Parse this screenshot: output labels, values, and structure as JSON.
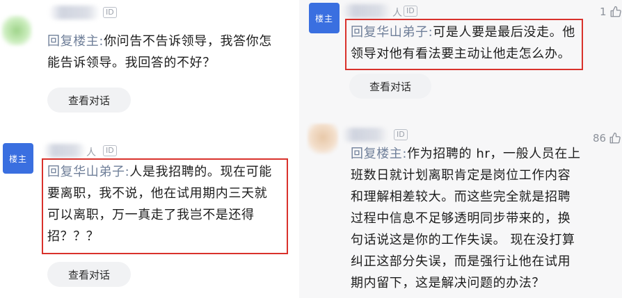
{
  "comments": [
    {
      "id_badge": "ID",
      "reply_prefix": "回复楼主:",
      "lines": [
        "你问告不告诉领导，我答你怎",
        "能告诉领导。我回答的不好？"
      ],
      "button": "查看对话"
    },
    {
      "avatar_label": "楼主",
      "name_suffix": "人",
      "id_badge": "ID",
      "reply_prefix": "回复华山弟子:",
      "lines": [
        "人是我招聘的。现在可能",
        "要离职，我不说，他在试用期内三天就",
        "可以离职，万一真走了我岂不是还得",
        "招？？？"
      ],
      "button": "查看对话"
    },
    {
      "avatar_label": "楼主",
      "name_suffix": "人",
      "id_badge": "ID",
      "reply_prefix": "回复华山弟子:",
      "lines": [
        "可是人要是最后没走。他",
        "领导对他有看法要主动让他走怎么办。"
      ],
      "button": "查看对话",
      "likes": "1"
    },
    {
      "id_badge": "ID",
      "reply_prefix": "回复楼主:",
      "lines": [
        "作为招聘的 hr，一般人员在上",
        "班数日就计划离职肯定是岗位工作内容",
        "和理解相差较大。而这些完全就是招聘",
        "过程中信息不足够透明同步带来的，换",
        "句话说这是你的工作失误。 现在没打算",
        "纠正这部分失误，而是强行让他在试用",
        "期内留下，这是解决问题的办法？"
      ],
      "likes": "86"
    }
  ],
  "colors": {
    "highlight_border": "#d9312b",
    "host_badge": "#3a6fe0",
    "reply_prefix": "#6f7f99"
  },
  "icons": {
    "like": "thumbs-up-icon"
  }
}
